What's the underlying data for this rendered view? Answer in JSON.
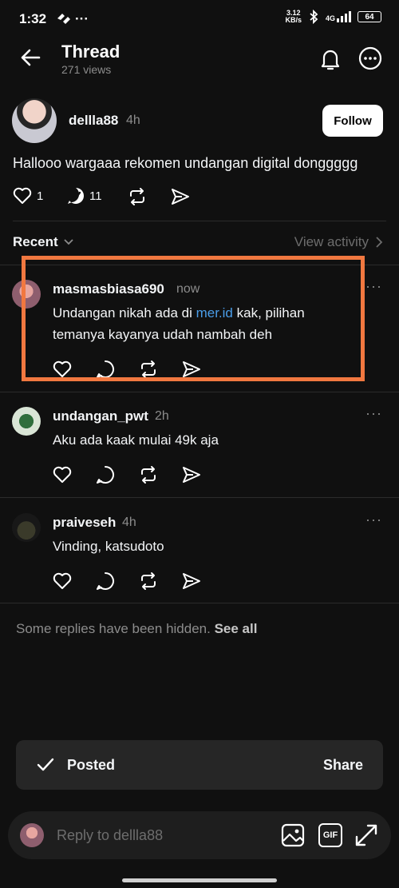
{
  "status_bar": {
    "time": "1:32",
    "speed_value": "3.12",
    "speed_unit": "KB/s",
    "network": "4G",
    "battery": "64"
  },
  "header": {
    "title": "Thread",
    "views": "271 views",
    "icons": [
      "back-arrow-icon",
      "bell-icon",
      "more-options-icon"
    ]
  },
  "post": {
    "username": "dellla88",
    "time": "4h",
    "follow_label": "Follow",
    "text": "Hallooo wargaaa rekomen undangan digital donggggg",
    "like_count": "1",
    "reply_count": "11"
  },
  "sort": {
    "label": "Recent",
    "view_activity": "View activity"
  },
  "replies": [
    {
      "username": "masmasbiasa690",
      "time": "now",
      "text_before": "Undangan nikah ada di ",
      "link": "mer.id",
      "text_after": " kak, pilihan temanya kayanya udah nambah deh"
    },
    {
      "username": "undangan_pwt",
      "time": "2h",
      "text": "Aku ada kaak mulai 49k aja"
    },
    {
      "username": "praiveseh",
      "time": "4h",
      "text": "Vinding, katsudoto"
    }
  ],
  "hidden_note": {
    "text": "Some replies have been hidden.",
    "link": "See all"
  },
  "toast": {
    "label": "Posted",
    "action": "Share"
  },
  "reply_bar": {
    "placeholder": "Reply to dellla88",
    "gif_label": "GIF"
  },
  "colors": {
    "background": "#101010",
    "highlight": "#f17840",
    "link": "#4a9de8"
  }
}
